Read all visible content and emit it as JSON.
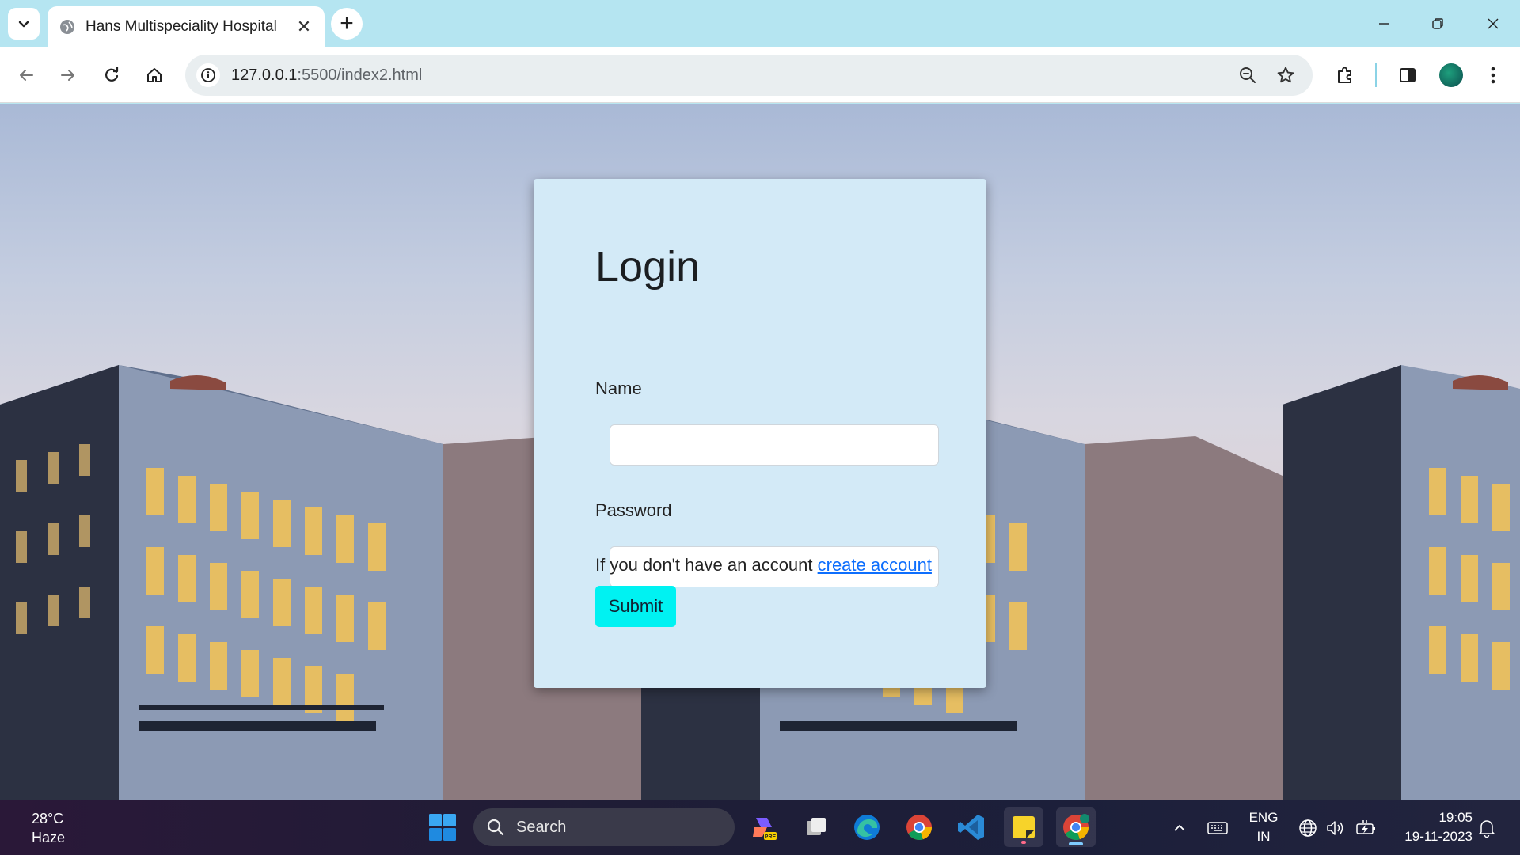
{
  "browser": {
    "tab": {
      "title": "Hans Multispeciality Hospital",
      "close_glyph": "✕"
    },
    "new_tab_glyph": "+",
    "omnibox": {
      "url_host": "127.0.0.1",
      "url_path": ":5500/index2.html"
    }
  },
  "page": {
    "login": {
      "title": "Login",
      "name_label": "Name",
      "name_value": "",
      "password_label": "Password",
      "password_value": "",
      "signup_text": "If you don't have an account ",
      "signup_link": "create account",
      "submit_label": "Submit"
    }
  },
  "taskbar": {
    "weather": {
      "temp": "28°C",
      "condition": "Haze"
    },
    "search_label": "Search",
    "language": {
      "lang": "ENG",
      "region": "IN"
    },
    "clock": {
      "time": "19:05",
      "date": "19-11-2023"
    }
  },
  "colors": {
    "tabstrip": "#b5e5f1",
    "card": "#d3eaf7",
    "submit": "#00f2f2",
    "link": "#0d6efd"
  }
}
